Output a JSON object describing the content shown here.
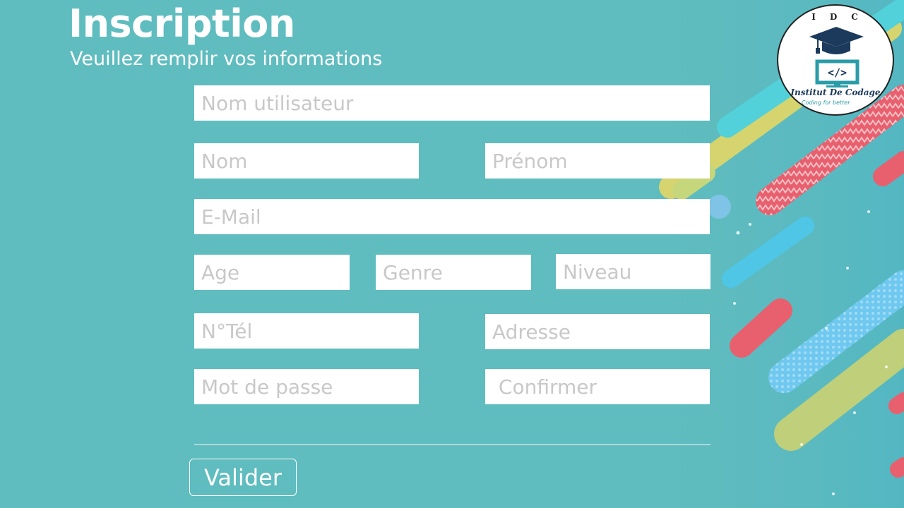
{
  "header": {
    "title": "Inscription",
    "subtitle": "Veuillez remplir vos informations"
  },
  "form": {
    "username": {
      "placeholder": "Nom utilisateur",
      "value": ""
    },
    "last_name": {
      "placeholder": "Nom",
      "value": ""
    },
    "first_name": {
      "placeholder": "Prénom",
      "value": ""
    },
    "email": {
      "placeholder": "E-Mail",
      "value": ""
    },
    "age": {
      "placeholder": "Age",
      "value": ""
    },
    "gender": {
      "placeholder": "Genre",
      "value": ""
    },
    "level": {
      "placeholder": "Niveau",
      "value": ""
    },
    "phone": {
      "placeholder": "N°Tél",
      "value": ""
    },
    "address": {
      "placeholder": "Adresse",
      "value": ""
    },
    "password": {
      "placeholder": "Mot de passe",
      "value": ""
    },
    "confirm": {
      "placeholder": " Confirmer",
      "value": ""
    },
    "submit_label": "Valider"
  },
  "logo": {
    "letters": "IDC",
    "name": "Institut De Codage",
    "tagline": "Coding for better",
    "icon": "graduation-cap-monitor-icon"
  },
  "colors": {
    "background": "#5fbcbf",
    "accent_red": "#e8606e",
    "accent_yellow": "#d9d36a",
    "accent_blue": "#4cc3de",
    "logo_navy": "#1b3a5c",
    "logo_teal": "#2a9ca8"
  }
}
